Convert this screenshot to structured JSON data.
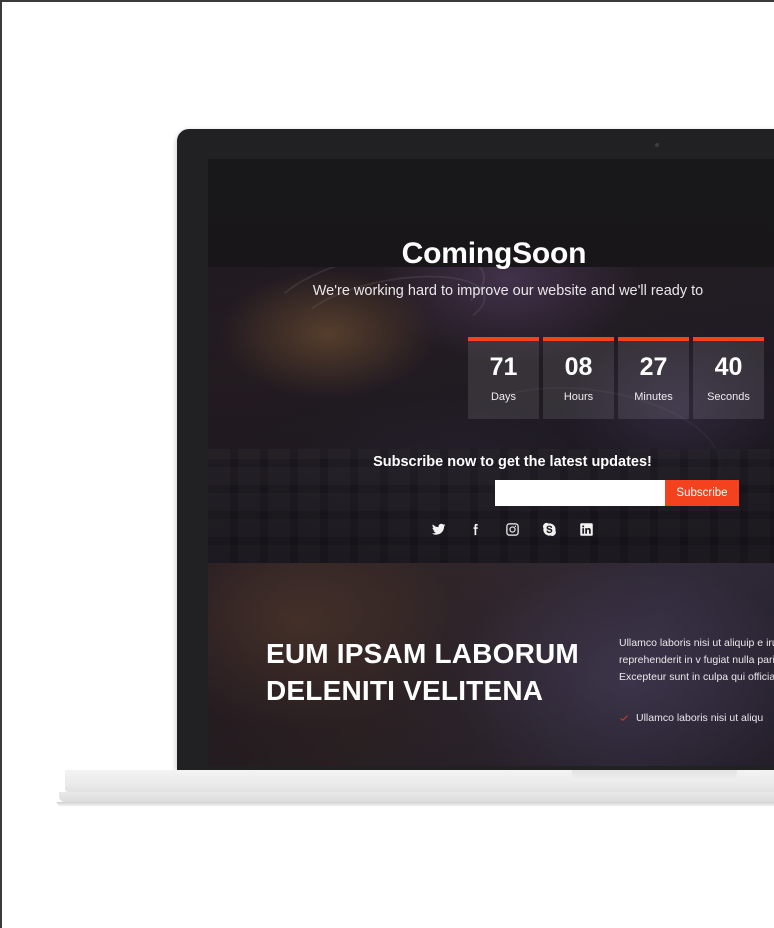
{
  "hero": {
    "brand_title": "ComingSoon",
    "subtitle": "We're working hard to improve our website and we'll ready to",
    "accent_color": "#f4411e"
  },
  "countdown": {
    "units": [
      {
        "value": "71",
        "label": "Days"
      },
      {
        "value": "08",
        "label": "Hours"
      },
      {
        "value": "27",
        "label": "Minutes"
      },
      {
        "value": "40",
        "label": "Seconds"
      }
    ]
  },
  "subscribe": {
    "title": "Subscribe now to get the latest updates!",
    "input_value": "",
    "input_placeholder": "",
    "button_label": "Subscribe"
  },
  "social": {
    "items": [
      {
        "icon": "twitter-icon"
      },
      {
        "icon": "facebook-icon"
      },
      {
        "icon": "instagram-icon"
      },
      {
        "icon": "skype-icon"
      },
      {
        "icon": "linkedin-icon"
      }
    ]
  },
  "content": {
    "heading": "EUM IPSAM LABORUM DELENITI VELITENA",
    "body": "Ullamco laboris nisi ut aliquip e irure dolor in reprehenderit in v fugiat nulla pariatur. Excepteur sunt in culpa qui officia deserun",
    "list": [
      {
        "text": "Ullamco laboris nisi ut aliqu",
        "icon": "check-icon"
      }
    ]
  },
  "device": {
    "type": "laptop-mockup",
    "webcam": "webcam-dot"
  }
}
